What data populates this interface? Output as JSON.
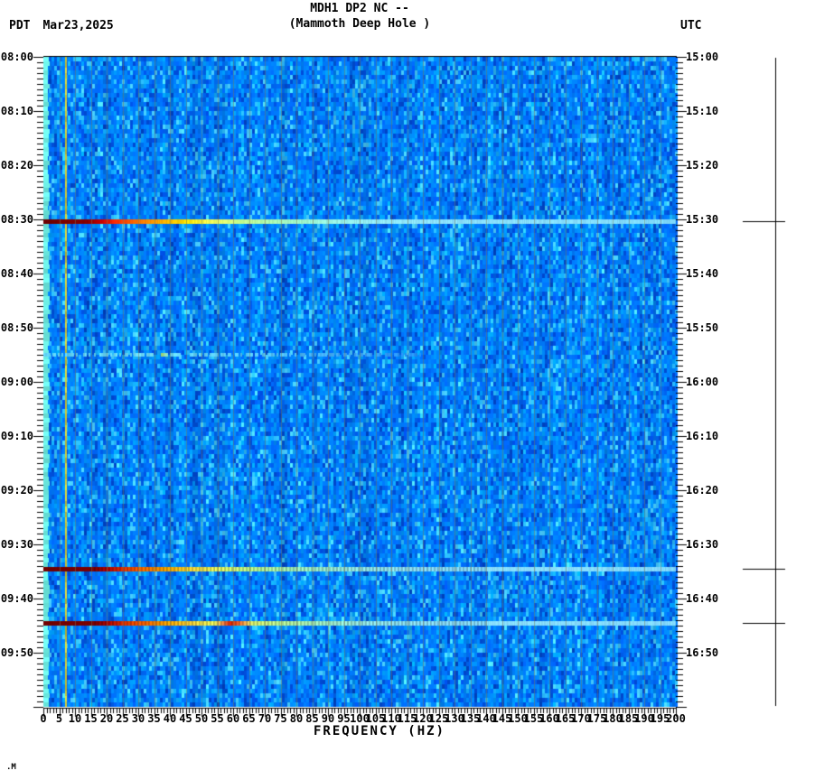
{
  "header": {
    "title": "MDH1 DP2 NC --",
    "subtitle": "(Mammoth Deep Hole )",
    "timezone_left": "PDT",
    "date": "Mar23,2025",
    "timezone_right": "UTC"
  },
  "footer_mark": ".M",
  "chart_data": {
    "type": "heatmap",
    "title": "MDH1 DP2 NC -- (Mammoth Deep Hole ) seismic spectrogram",
    "xlabel": "FREQUENCY (HZ)",
    "x_range_hz": [
      0,
      200
    ],
    "x_major_tick_step_hz": 5,
    "x_minor_tick_step_hz": 1,
    "x_tick_labels": [
      "0",
      "5",
      "10",
      "15",
      "20",
      "25",
      "30",
      "35",
      "40",
      "45",
      "50",
      "55",
      "60",
      "65",
      "70",
      "75",
      "80",
      "85",
      "90",
      "95",
      "100",
      "105",
      "110",
      "115",
      "120",
      "125",
      "130",
      "135",
      "140",
      "145",
      "150",
      "155",
      "160",
      "165",
      "170",
      "175",
      "180",
      "185",
      "190",
      "195",
      "200"
    ],
    "time_axis": {
      "left_timezone": "PDT",
      "right_timezone": "UTC",
      "start_left": "08:00",
      "end_left": "10:00",
      "minutes_total": 120,
      "major_tick_minutes": 10,
      "minor_tick_minutes": 1,
      "left_tick_labels": [
        "08:00",
        "08:10",
        "08:20",
        "08:30",
        "08:40",
        "08:50",
        "09:00",
        "09:10",
        "09:20",
        "09:30",
        "09:40",
        "09:50"
      ],
      "right_tick_labels": [
        "15:00",
        "15:10",
        "15:20",
        "15:30",
        "15:40",
        "15:50",
        "16:00",
        "16:10",
        "16:20",
        "16:30",
        "16:40",
        "16:50"
      ]
    },
    "background": {
      "noise_palette": [
        "#0050dc",
        "#005ce8",
        "#0066f4",
        "#006cff",
        "#0074ff",
        "#0074ff",
        "#007cff",
        "#007cff",
        "#0084ff",
        "#0084ff",
        "#008cff",
        "#0094ff",
        "#00a0ff",
        "#14acff",
        "#2cbcff",
        "#48ccff",
        "#0048d0"
      ],
      "left_edge_band_color": "#6ceee4",
      "vertical_line_hz": 7,
      "vertical_line_color": "#ccc838",
      "graticule_step_hz": 5,
      "graticule_color": "rgba(118,118,88,0.5)"
    },
    "event_marker_bar": {
      "side": "right",
      "marked_event_times_pdt": [
        "08:30",
        "09:34",
        "09:44"
      ]
    },
    "events": [
      {
        "time_pdt": "08:30",
        "time_utc": "15:30",
        "minutes_from_start": 30.3,
        "strength": "strong",
        "striped": false,
        "max_freq_hz": 200,
        "marked_on_right_bar": true,
        "color_stops": [
          [
            0,
            "#6e0000"
          ],
          [
            14,
            "#8a0000"
          ],
          [
            18,
            "#c40000"
          ],
          [
            23,
            "#ff2e00"
          ],
          [
            29,
            "#ff6c00"
          ],
          [
            37,
            "#ffaa00"
          ],
          [
            45,
            "#ffe400"
          ],
          [
            53,
            "#f2ff5a"
          ],
          [
            62,
            "#c6ff8e"
          ],
          [
            74,
            "#a8fcba"
          ],
          [
            88,
            "#9af4dc"
          ],
          [
            105,
            "#92eaf6"
          ],
          [
            125,
            "#8ce2ff"
          ],
          [
            200,
            "#80dcff"
          ]
        ]
      },
      {
        "time_pdt": "08:55",
        "time_utc": "15:55",
        "minutes_from_start": 55.0,
        "strength": "faint",
        "striped": false,
        "max_freq_hz": 120,
        "marked_on_right_bar": false,
        "color_stops": [
          [
            0,
            "#60d4f8"
          ],
          [
            34,
            "#6cdaf8"
          ],
          [
            37,
            "#b2e878"
          ],
          [
            40,
            "#68d8f8"
          ],
          [
            70,
            "#52c2f6"
          ],
          [
            100,
            "#3ca4fa"
          ],
          [
            120,
            "#2490ff"
          ]
        ]
      },
      {
        "time_pdt": "09:34",
        "time_utc": "16:34",
        "minutes_from_start": 94.5,
        "strength": "strong",
        "striped": true,
        "max_freq_hz": 200,
        "marked_on_right_bar": true,
        "color_stops": [
          [
            0,
            "#700000"
          ],
          [
            16,
            "#7e0000"
          ],
          [
            20,
            "#b40000"
          ],
          [
            25,
            "#e83200"
          ],
          [
            31,
            "#ff6a00"
          ],
          [
            39,
            "#ffae00"
          ],
          [
            47,
            "#ffe23e"
          ],
          [
            56,
            "#e6ff66"
          ],
          [
            66,
            "#beff92"
          ],
          [
            80,
            "#a4f8c4"
          ],
          [
            98,
            "#96eee8"
          ],
          [
            118,
            "#8ce2ff"
          ],
          [
            200,
            "#82d8ff"
          ]
        ]
      },
      {
        "time_pdt": "09:44",
        "time_utc": "16:44",
        "minutes_from_start": 104.5,
        "strength": "strong",
        "striped": true,
        "max_freq_hz": 200,
        "marked_on_right_bar": true,
        "color_stops": [
          [
            0,
            "#700000"
          ],
          [
            16,
            "#7e0000"
          ],
          [
            20,
            "#b20000"
          ],
          [
            25,
            "#e03000"
          ],
          [
            31,
            "#ff5e00"
          ],
          [
            39,
            "#ffa600"
          ],
          [
            47,
            "#ffdc3e"
          ],
          [
            54,
            "#f0ff5e"
          ],
          [
            57,
            "#ff8246"
          ],
          [
            59,
            "#e62600"
          ],
          [
            62,
            "#ff7434"
          ],
          [
            66,
            "#e4ff74"
          ],
          [
            74,
            "#c2ff9a"
          ],
          [
            88,
            "#a6f8cc"
          ],
          [
            104,
            "#94ecf2"
          ],
          [
            122,
            "#8ce2ff"
          ],
          [
            200,
            "#82d8ff"
          ]
        ]
      }
    ]
  }
}
